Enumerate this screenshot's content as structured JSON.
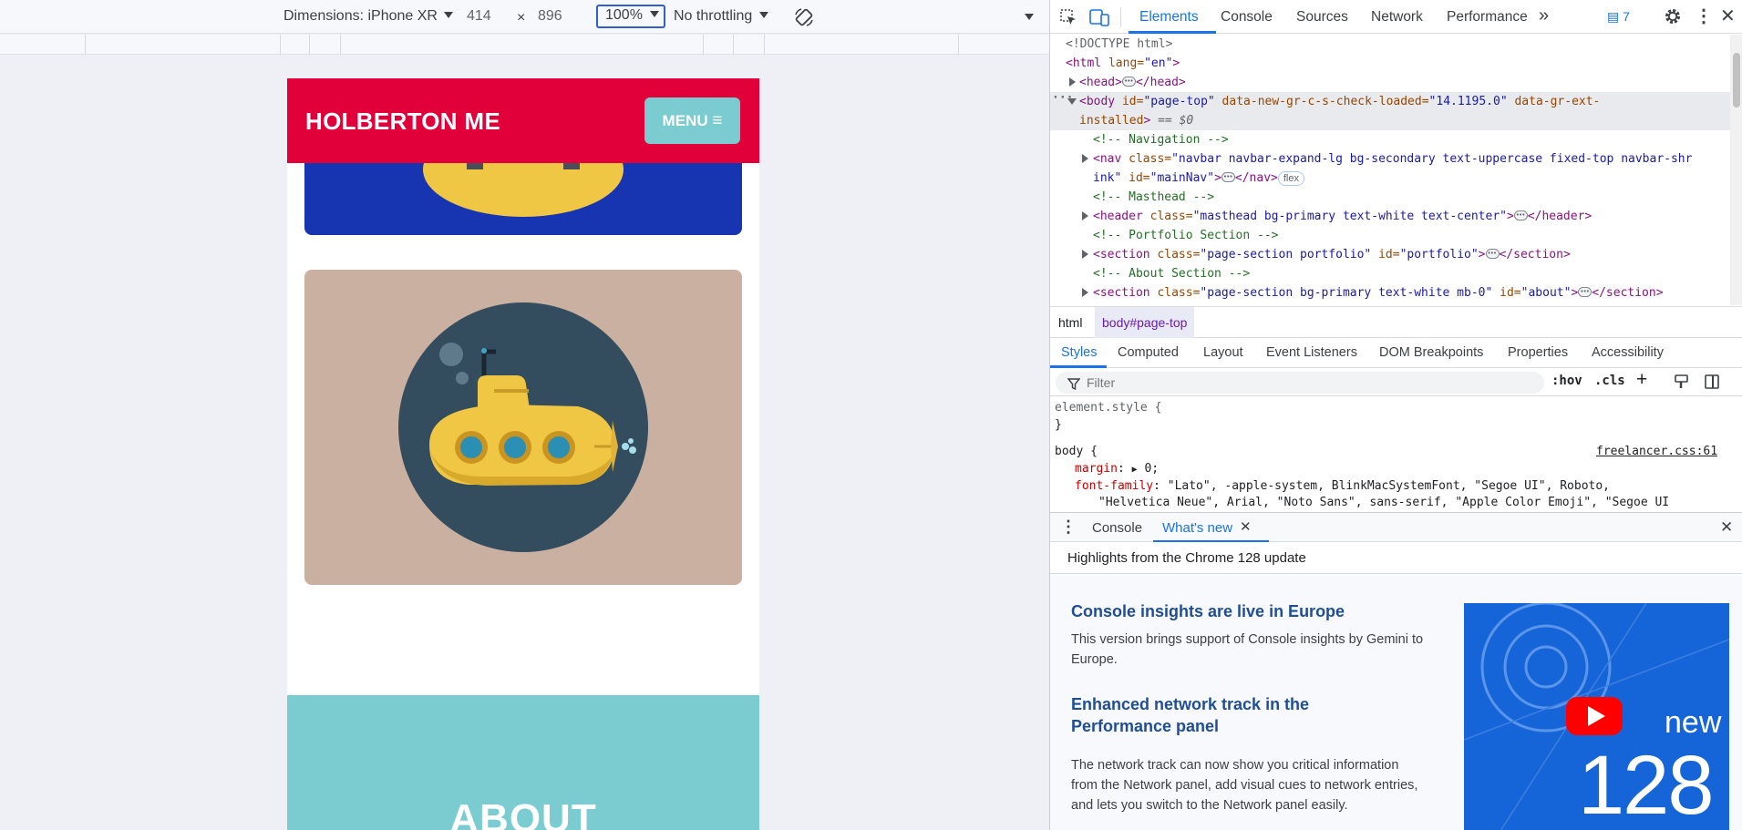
{
  "device_toolbar": {
    "dimensions_label": "Dimensions: iPhone XR",
    "width": "414",
    "height": "896",
    "times": "×",
    "zoom": "100%",
    "throttling": "No throttling"
  },
  "site": {
    "brand": "HOLBERTON ME",
    "menu_label": "MENU",
    "about_title": "ABOUT",
    "colors": {
      "primary": "#e2003b",
      "secondary": "#7accd1",
      "card_blue": "#1735b0",
      "card_tan": "#c9b0a1"
    }
  },
  "devtools": {
    "tabs": [
      "Elements",
      "Console",
      "Sources",
      "Network",
      "Performance"
    ],
    "issues_count": "7",
    "dom": {
      "doctype": "<!DOCTYPE html>",
      "html_open": "<html ",
      "html_attr": "lang=",
      "html_val": "\"en\"",
      "head_open": "<head>",
      "head_close": "</head>",
      "body_tag": "<body ",
      "body_id_attr": "id=",
      "body_id_val": "\"page-top\"",
      "body_attr2": " data-new-gr-c-s-check-loaded=",
      "body_val2": "\"14.1195.0\"",
      "body_attr3": " data-gr-ext-",
      "body_attr3b": "installed",
      "body_close": ">",
      "selected_marker": "== $0",
      "comment_nav": "<!-- Navigation -->",
      "nav_tag": "<nav ",
      "nav_class_attr": "class=",
      "nav_class_val": "\"navbar navbar-expand-lg bg-secondary text-uppercase fixed-top navbar-shr",
      "nav_class_val2": "ink\"",
      "nav_id_attr": " id=",
      "nav_id_val": "\"mainNav\"",
      "nav_close": "</nav>",
      "flex_badge": "flex",
      "comment_masthead": "<!-- Masthead -->",
      "header_tag": "<header ",
      "header_class_val": "\"masthead bg-primary text-white text-center\"",
      "header_close": "</header>",
      "comment_portfolio": "<!-- Portfolio Section -->",
      "section_tag": "<section ",
      "portfolio_class_val": "\"page-section portfolio\"",
      "portfolio_id_val": "\"portfolio\"",
      "section_close": "</section>",
      "comment_about": "<!-- About Section -->",
      "about_class_val": "\"page-section bg-primary text-white mb-0\"",
      "about_id_val": "\"about\""
    },
    "breadcrumbs": [
      "html",
      "body#page-top"
    ],
    "subtabs": [
      "Styles",
      "Computed",
      "Layout",
      "Event Listeners",
      "DOM Breakpoints",
      "Properties",
      "Accessibility"
    ],
    "filter_placeholder": "Filter",
    "hov": ":hov",
    "cls": ".cls",
    "styles": {
      "element_style": "element.style {",
      "close_brace": "}",
      "body_selector": "body {",
      "source_link": "freelancer.css:61",
      "margin_prop": "margin",
      "margin_val": "0;",
      "font_prop": "font-family",
      "font_val": "\"Lato\", -apple-system, BlinkMacSystemFont, \"Segoe UI\", Roboto,",
      "font_val2": "\"Helvetica Neue\", Arial, \"Noto Sans\", sans-serif, \"Apple Color Emoji\", \"Segoe UI"
    },
    "drawer_tabs": [
      "Console",
      "What's new"
    ],
    "whats_new": {
      "highlight": "Highlights from the Chrome 128 update",
      "h1": "Console insights are live in Europe",
      "p1": "This version brings support of Console insights by Gemini to Europe.",
      "h2": "Enhanced network track in the Performance panel",
      "p2": "The network track can now show you critical information from the Network panel, add visual cues to network entries, and lets you switch to the Network panel easily.",
      "thumb_new": "new",
      "thumb_num": "128"
    }
  }
}
